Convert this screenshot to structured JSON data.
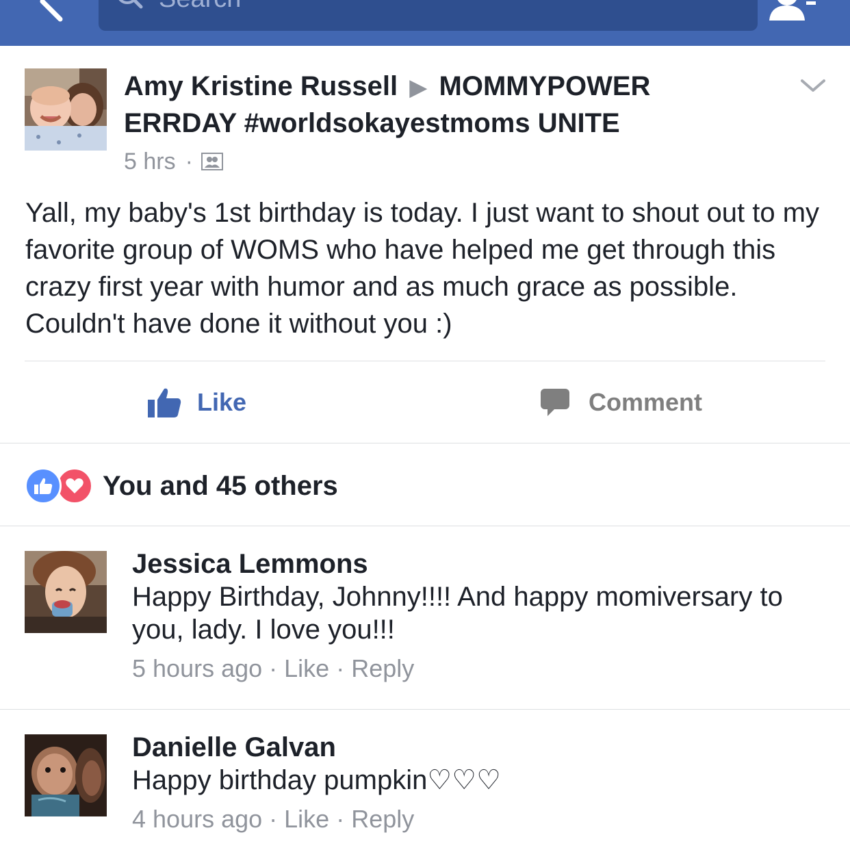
{
  "topbar": {
    "search_placeholder": "Search",
    "back_icon": "back-arrow-icon",
    "friends_icon": "friend-requests-icon",
    "bar_color": "#4267b2"
  },
  "post": {
    "author": "Amy Kristine Russell",
    "separator": "▶",
    "group": "MOMMYPOWER ERRDAY #worldsokayestmoms UNITE",
    "time": "5 hrs",
    "meta_dot": "·",
    "audience_icon": "group-audience-icon",
    "body": "Yall, my baby's 1st  birthday is today. I just want to shout out to my favorite group of WOMS who have helped me get through this crazy first year with humor and as much grace as possible. Couldn't have done it without you :)"
  },
  "actions": {
    "like_label": "Like",
    "comment_label": "Comment",
    "like_color": "#4267b2"
  },
  "reactions": {
    "summary": "You and 45 others",
    "icons": [
      "like-reaction-icon",
      "love-reaction-icon"
    ]
  },
  "comments": [
    {
      "name": "Jessica Lemmons",
      "text": "Happy Birthday, Johnny!!!! And happy momiversary to you, lady. I love you!!!",
      "time": "5 hours ago",
      "like": "Like",
      "reply": "Reply"
    },
    {
      "name": "Danielle Galvan",
      "text": "Happy birthday pumpkin♡♡♡",
      "time": "4 hours ago",
      "like": "Like",
      "reply": "Reply"
    }
  ],
  "sep_dot": "·"
}
